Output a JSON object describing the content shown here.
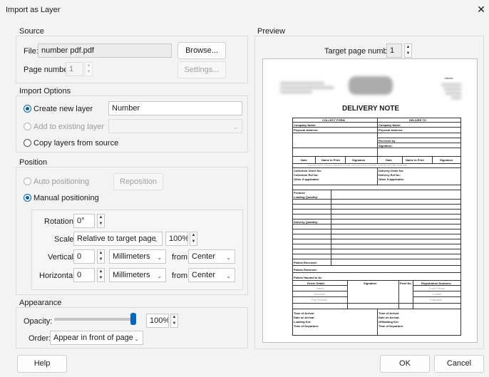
{
  "window": {
    "title": "Import as Layer"
  },
  "source": {
    "group_label": "Source",
    "file_label": "File:",
    "file_value": "number pdf.pdf",
    "browse_label": "Browse...",
    "page_label": "Page number:",
    "page_value": "1",
    "settings_label": "Settings..."
  },
  "import_options": {
    "group_label": "Import Options",
    "create_label": "Create new layer",
    "layer_name": "Number",
    "add_label": "Add to existing layer",
    "copy_label": "Copy layers from source"
  },
  "position": {
    "group_label": "Position",
    "auto_label": "Auto positioning",
    "reposition_label": "Reposition",
    "manual_label": "Manual positioning",
    "rotation_label": "Rotation:",
    "rotation_value": "0°",
    "scale_label": "Scale:",
    "scale_mode": "Relative to target page",
    "scale_value": "100%",
    "vertical_label": "Vertical:",
    "vertical_value": "0",
    "vertical_unit": "Millimeters",
    "from_label": "from",
    "vertical_from": "Center",
    "horizontal_label": "Horizontal:",
    "horizontal_value": "0",
    "horizontal_unit": "Millimeters",
    "horizontal_from": "Center"
  },
  "appearance": {
    "group_label": "Appearance",
    "opacity_label": "Opacity:",
    "opacity_value": "100%",
    "opacity_level": 1.0,
    "order_label": "Order:",
    "order_value": "Appear in front of page"
  },
  "preview": {
    "group_label": "Preview",
    "target_label": "Target page number:",
    "target_value": "1",
    "doc": {
      "num_tag": "<Num>",
      "title": "DELIVERY NOTE",
      "collect_form": "COLLECT FORM",
      "deliver_to": "DELIVER TO",
      "company_name": "Company Name:",
      "physical_address": "Physical Address:",
      "received_by": "Received by:",
      "signature_label": "Signature:",
      "col_date": "Date",
      "col_name_print": "Name in Print",
      "col_signature": "Signature",
      "note": "PLEASE NOTE: SHOULD VEHICLE STAND LONGER THAN 4 HOURS, R400 P/H WILL BE CHARGED",
      "collection_order": "Collection Order No:",
      "collection_ref": "Collection Ref No:",
      "other_left": "Other if applicable:",
      "delivery_order": "Delivery Order No:",
      "delivery_ref": "Delivery Ref No:",
      "other_right": "Other if applicable:",
      "product": "Product:",
      "loading_qty": "Loading Quantity:",
      "delivery_qty": "Delivery Quantity:",
      "pallets_received": "Pallets Received:",
      "pallets_returned": "Pallets Returned:",
      "pallets_handed": "Pallets Handed in At:",
      "driver_detail": "Driver Detail:",
      "sig": "Signature",
      "fleet_no": "Fleet No",
      "registration": "Registration Numbers",
      "name_ph": "Name",
      "surname_ph": "Surname",
      "pay_ph": "Pay Number",
      "truck_ph": "Truck/ Horse",
      "loader_ph": "Loader",
      "fullpower_ph": "Fullpower",
      "time_arrival": "Time of Arrival:",
      "date_arrival": "Date on Arrival:",
      "loading_km": "Loading Km:",
      "time_departure": "Time of Departure:",
      "time_arrival2": "Time of Arrival:",
      "date_arrival2": "Date on Arrival:",
      "offloading_km": "Offloading Km:",
      "time_departure2": "Time of Departure:"
    }
  },
  "footer": {
    "help_label": "Help",
    "ok_label": "OK",
    "cancel_label": "Cancel"
  }
}
